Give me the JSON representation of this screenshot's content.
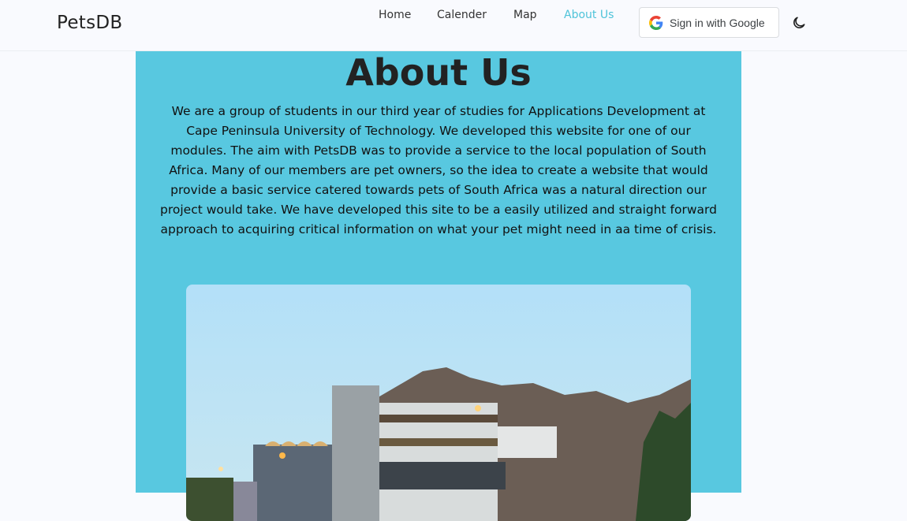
{
  "nav": {
    "brand": "PetsDB",
    "links": [
      {
        "label": "Home"
      },
      {
        "label": "Calender"
      },
      {
        "label": "Map"
      },
      {
        "label": "About Us",
        "active": true
      }
    ],
    "google_button": "Sign in with Google",
    "theme_toggle_icon": "moon-icon",
    "accent": "#4fc3d9"
  },
  "main": {
    "title": "About Us",
    "paragraph": "We are a group of students in our third year of studies for Applications Development at Cape Peninsula University of Technology. We developed this website for one of our modules. The aim with PetsDB was to provide a service to the local population of South Africa. Many of our members are pet owners, so the idea to create a website that would provide a basic service catered towards pets of South Africa was a natural direction our project would take. We have developed this site to be a easily utilized and straight forward approach to acquiring critical information on what your pet might need in aa time of crisis.",
    "image": "campus-building-photo",
    "card_color": "#58c8e0"
  }
}
